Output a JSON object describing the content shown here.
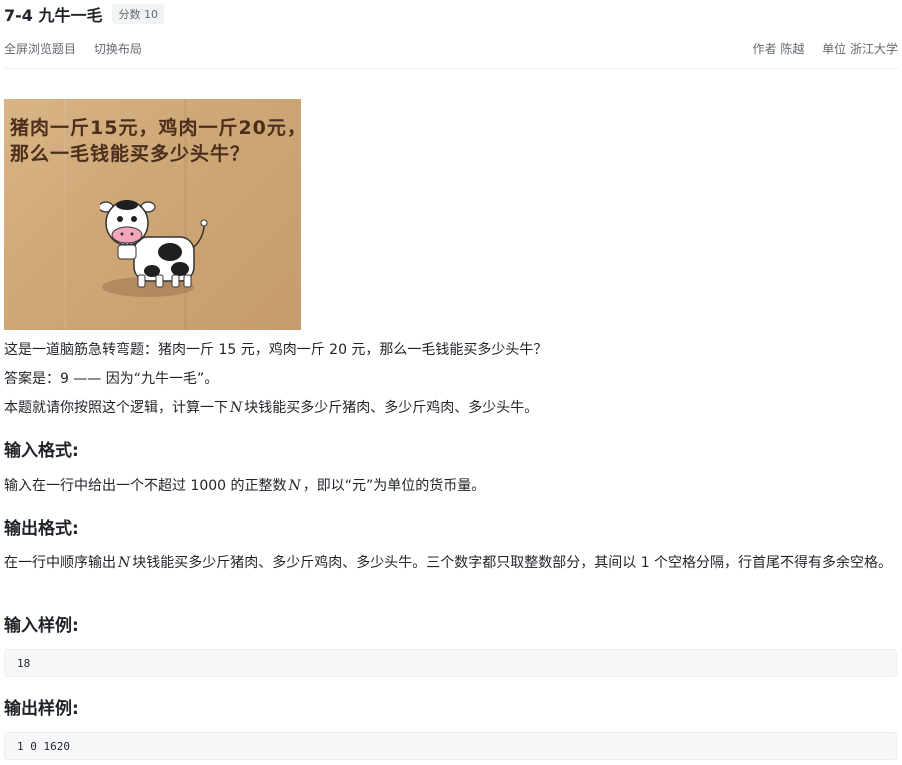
{
  "problem": {
    "title": "7-4 九牛一毛",
    "score_label": "分数 10"
  },
  "toolbar": {
    "fullscreen": "全屏浏览题目",
    "switch_layout": "切换布局",
    "author": "作者 陈越",
    "unit": "单位 浙江大学"
  },
  "image": {
    "line1": "猪肉一斤15元，鸡肉一斤20元，",
    "line2": "那么一毛钱能买多少头牛？"
  },
  "description": {
    "p1": "这是一道脑筋急转弯题：猪肉一斤 15 元，鸡肉一斤 20 元，那么一毛钱能买多少头牛？",
    "p2": "答案是：9 —— 因为“九牛一毛”。",
    "p3_before": "本题就请你按照这个逻辑，计算一下",
    "p3_var": "N",
    "p3_after": "块钱能买多少斤猪肉、多少斤鸡肉、多少头牛。"
  },
  "input_format": {
    "heading": "输入格式:",
    "before": "输入在一行中给出一个不超过 1000 的正整数",
    "var": "N",
    "after": "，即以“元”为单位的货币量。"
  },
  "output_format": {
    "heading": "输出格式:",
    "before": "在一行中顺序输出",
    "var": "N",
    "after": "块钱能买多少斤猪肉、多少斤鸡肉、多少头牛。三个数字都只取整数部分，其间以 1 个空格分隔，行首尾不得有多余空格。"
  },
  "sample_input": {
    "heading": "输入样例:",
    "code": "18"
  },
  "sample_output": {
    "heading": "输出样例:",
    "code": "1 0 1620"
  }
}
